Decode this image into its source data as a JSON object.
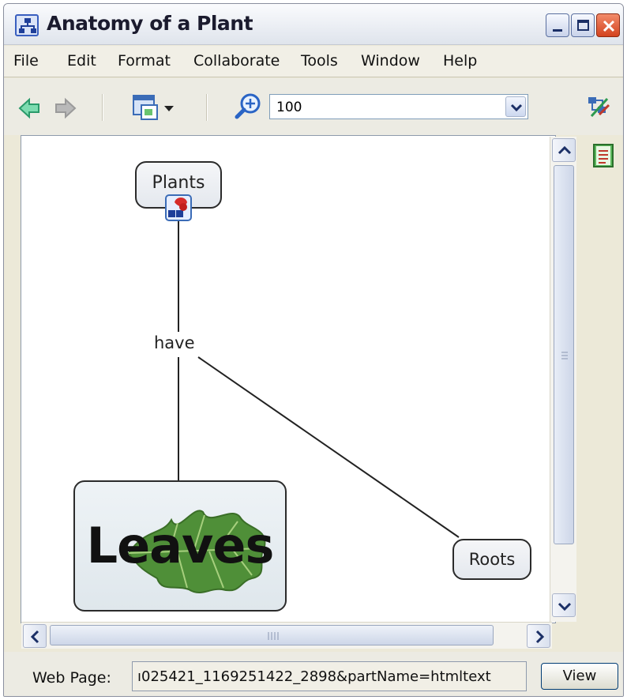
{
  "window": {
    "title": "Anatomy of a Plant"
  },
  "menu": {
    "items": [
      "File",
      "Edit",
      "Format",
      "Collaborate",
      "Tools",
      "Window",
      "Help"
    ]
  },
  "toolbar": {
    "zoom_value": "100",
    "icons": [
      "back-arrow-icon",
      "forward-arrow-icon",
      "concept-view-icon",
      "zoom-icon",
      "collaboration-icon",
      "notes-icon"
    ]
  },
  "concept_map": {
    "nodes": {
      "plants": "Plants",
      "leaves": "Leaves",
      "roots": "Roots"
    },
    "link_phrase": "have"
  },
  "statusbar": {
    "label": "Web Page:",
    "url": "ı025421_1169251422_2898&partName=htmltext",
    "view_label": "View"
  },
  "colors": {
    "window_bg": "#ece9d8",
    "canvas_bg": "#ffffff",
    "close_button": "#d3431f",
    "node_border": "#2b2b2b"
  }
}
